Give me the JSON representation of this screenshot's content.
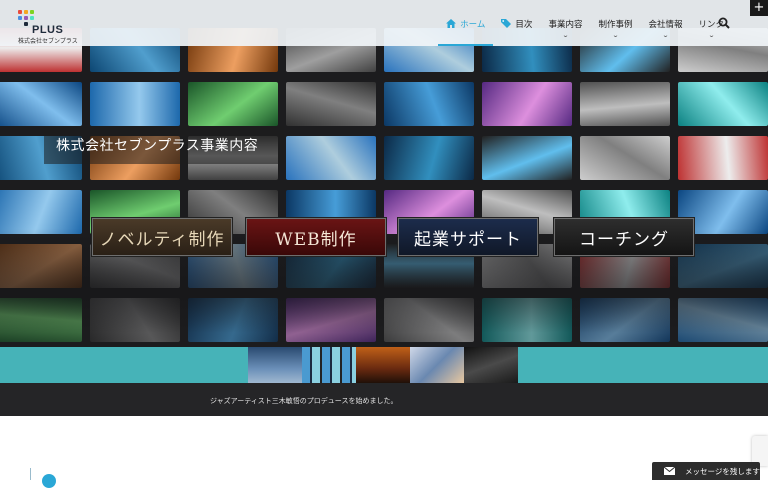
{
  "header": {
    "logo_text": "PLUS",
    "logo_sub": "株式会社セブンプラス",
    "nav": [
      {
        "label": "ホーム",
        "icon": "home-icon",
        "active": true,
        "has_dropdown": false
      },
      {
        "label": "目次",
        "icon": "tag-icon",
        "active": false,
        "has_dropdown": false
      },
      {
        "label": "事業内容",
        "icon": "",
        "active": false,
        "has_dropdown": true
      },
      {
        "label": "制作事例",
        "icon": "",
        "active": false,
        "has_dropdown": true
      },
      {
        "label": "会社情報",
        "icon": "",
        "active": false,
        "has_dropdown": true
      },
      {
        "label": "リンク",
        "icon": "",
        "active": false,
        "has_dropdown": true
      }
    ],
    "search_icon": "search-icon",
    "corner_button": "+"
  },
  "hero": {
    "title": "株式会社セブンプラス事業内容",
    "services": [
      "ノベルティ制作",
      "WEB制作",
      "起業サポート",
      "コーチング"
    ]
  },
  "ticker": {
    "text": "ジャズアーティスト三木敏悟のプロデュースを始めました。"
  },
  "message_button": {
    "label": "メッセージを残します",
    "icon": "envelope-icon"
  },
  "colors": {
    "accent": "#2aa7d6",
    "band": "#46b3b8",
    "hero_bg": "#1c1c1e",
    "ticker_bg": "#252527"
  }
}
